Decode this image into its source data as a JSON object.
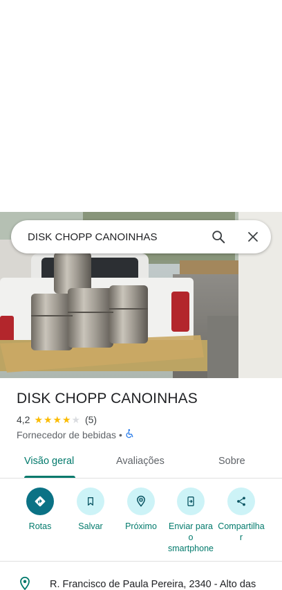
{
  "search": {
    "query": "DISK CHOPP CANOINHAS"
  },
  "icons": {
    "search": "search-icon",
    "close": "close-icon",
    "wheelchair": "wheelchair-icon",
    "pin": "location-pin-icon"
  },
  "place": {
    "name": "DISK CHOPP CANOINHAS",
    "rating": "4,2",
    "rating_value": 4.2,
    "stars_filled": 4,
    "review_count": "(5)",
    "category": "Fornecedor de bebidas",
    "separator": "•"
  },
  "tabs": [
    {
      "label": "Visão geral",
      "active": true
    },
    {
      "label": "Avaliações",
      "active": false
    },
    {
      "label": "Sobre",
      "active": false
    }
  ],
  "actions": [
    {
      "label": "Rotas",
      "icon": "directions-icon"
    },
    {
      "label": "Salvar",
      "icon": "bookmark-icon"
    },
    {
      "label": "Próximo",
      "icon": "nearby-icon"
    },
    {
      "label_lines": [
        "Enviar para",
        "o",
        "smartphone"
      ],
      "icon": "send-to-phone-icon"
    },
    {
      "label_lines": [
        "Compartilha",
        "r"
      ],
      "icon": "share-icon"
    }
  ],
  "address": {
    "text": "R. Francisco de Paula Pereira, 2340 - Alto das"
  },
  "colors": {
    "accent": "#00796b",
    "primary_button": "#0b7285",
    "action_bg": "#cdf3f7",
    "star": "#fbbc04"
  }
}
